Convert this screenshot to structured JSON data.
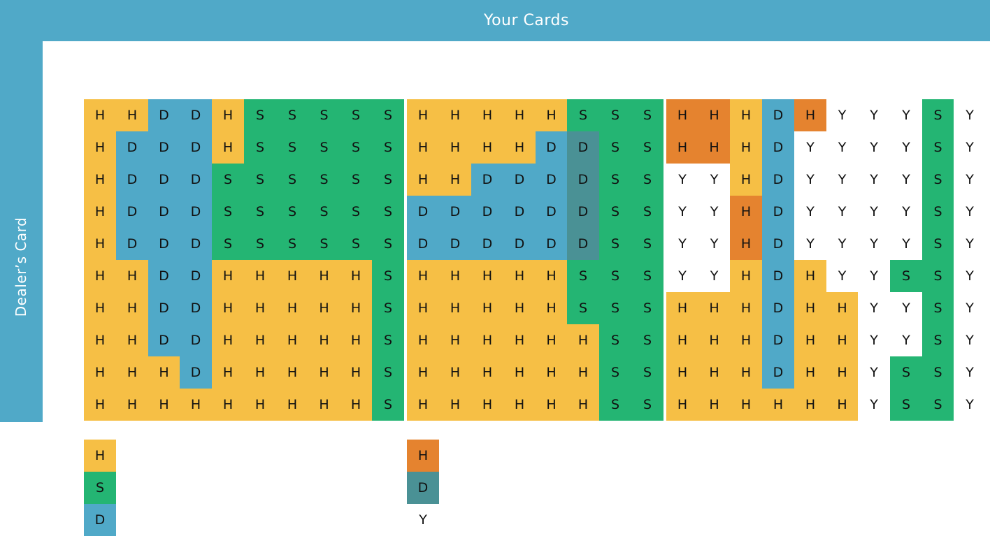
{
  "header": {
    "title": "Your Cards"
  },
  "side": {
    "title": "Dealer’s Card"
  },
  "colors": {
    "H": "#F6BF45",
    "S": "#24B573",
    "D": "#50A9C8",
    "Ho": "#E5832F",
    "Dt": "#4A9195",
    "Y": "#ffffff",
    "band": "#50A9C8"
  },
  "chart_data": {
    "type": "table",
    "title": "Your Cards",
    "row_axis_label": "Dealer’s Card",
    "column_axis_label": "Your Cards",
    "code_letters": {
      "H": "H",
      "S": "S",
      "D": "D",
      "Ho": "H",
      "Dt": "D",
      "Y": "Y"
    },
    "sections": [
      {
        "name": "section-1",
        "rows": [
          [
            "H",
            "H",
            "D",
            "D",
            "H",
            "S",
            "S",
            "S",
            "S",
            "S"
          ],
          [
            "H",
            "D",
            "D",
            "D",
            "H",
            "S",
            "S",
            "S",
            "S",
            "S"
          ],
          [
            "H",
            "D",
            "D",
            "D",
            "S",
            "S",
            "S",
            "S",
            "S",
            "S"
          ],
          [
            "H",
            "D",
            "D",
            "D",
            "S",
            "S",
            "S",
            "S",
            "S",
            "S"
          ],
          [
            "H",
            "D",
            "D",
            "D",
            "S",
            "S",
            "S",
            "S",
            "S",
            "S"
          ],
          [
            "H",
            "H",
            "D",
            "D",
            "H",
            "H",
            "H",
            "H",
            "H",
            "S"
          ],
          [
            "H",
            "H",
            "D",
            "D",
            "H",
            "H",
            "H",
            "H",
            "H",
            "S"
          ],
          [
            "H",
            "H",
            "D",
            "D",
            "H",
            "H",
            "H",
            "H",
            "H",
            "S"
          ],
          [
            "H",
            "H",
            "H",
            "D",
            "H",
            "H",
            "H",
            "H",
            "H",
            "S"
          ],
          [
            "H",
            "H",
            "H",
            "H",
            "H",
            "H",
            "H",
            "H",
            "H",
            "S"
          ]
        ]
      },
      {
        "name": "section-2",
        "rows": [
          [
            "H",
            "H",
            "H",
            "H",
            "H",
            "S",
            "S",
            "S"
          ],
          [
            "H",
            "H",
            "H",
            "H",
            "D",
            "Dt",
            "S",
            "S"
          ],
          [
            "H",
            "H",
            "D",
            "D",
            "D",
            "Dt",
            "S",
            "S"
          ],
          [
            "D",
            "D",
            "D",
            "D",
            "D",
            "Dt",
            "S",
            "S"
          ],
          [
            "D",
            "D",
            "D",
            "D",
            "D",
            "Dt",
            "S",
            "S"
          ],
          [
            "H",
            "H",
            "H",
            "H",
            "H",
            "S",
            "S",
            "S"
          ],
          [
            "H",
            "H",
            "H",
            "H",
            "H",
            "S",
            "S",
            "S"
          ],
          [
            "H",
            "H",
            "H",
            "H",
            "H",
            "H",
            "S",
            "S"
          ],
          [
            "H",
            "H",
            "H",
            "H",
            "H",
            "H",
            "S",
            "S"
          ],
          [
            "H",
            "H",
            "H",
            "H",
            "H",
            "H",
            "S",
            "S"
          ]
        ]
      },
      {
        "name": "section-3",
        "rows": [
          [
            "Ho",
            "Ho",
            "H",
            "D",
            "Ho",
            "Y",
            "Y",
            "Y",
            "S",
            "Y"
          ],
          [
            "Ho",
            "Ho",
            "H",
            "D",
            "Y",
            "Y",
            "Y",
            "Y",
            "S",
            "Y"
          ],
          [
            "Y",
            "Y",
            "H",
            "D",
            "Y",
            "Y",
            "Y",
            "Y",
            "S",
            "Y"
          ],
          [
            "Y",
            "Y",
            "Ho",
            "D",
            "Y",
            "Y",
            "Y",
            "Y",
            "S",
            "Y"
          ],
          [
            "Y",
            "Y",
            "Ho",
            "D",
            "Y",
            "Y",
            "Y",
            "Y",
            "S",
            "Y"
          ],
          [
            "Y",
            "Y",
            "H",
            "D",
            "H",
            "Y",
            "Y",
            "S",
            "S",
            "Y"
          ],
          [
            "H",
            "H",
            "H",
            "D",
            "H",
            "H",
            "Y",
            "Y",
            "S",
            "Y"
          ],
          [
            "H",
            "H",
            "H",
            "D",
            "H",
            "H",
            "Y",
            "Y",
            "S",
            "Y"
          ],
          [
            "H",
            "H",
            "H",
            "D",
            "H",
            "H",
            "Y",
            "S",
            "S",
            "Y"
          ],
          [
            "H",
            "H",
            "H",
            "H",
            "H",
            "H",
            "Y",
            "S",
            "S",
            "Y"
          ]
        ]
      }
    ],
    "legend": [
      {
        "code": "H",
        "label": "H",
        "group": "left"
      },
      {
        "code": "S",
        "label": "S",
        "group": "left"
      },
      {
        "code": "D",
        "label": "D",
        "group": "left"
      },
      {
        "code": "Ho",
        "label": "H",
        "group": "right"
      },
      {
        "code": "Dt",
        "label": "D",
        "group": "right"
      },
      {
        "code": "Y",
        "label": "Y",
        "group": "right"
      }
    ]
  }
}
